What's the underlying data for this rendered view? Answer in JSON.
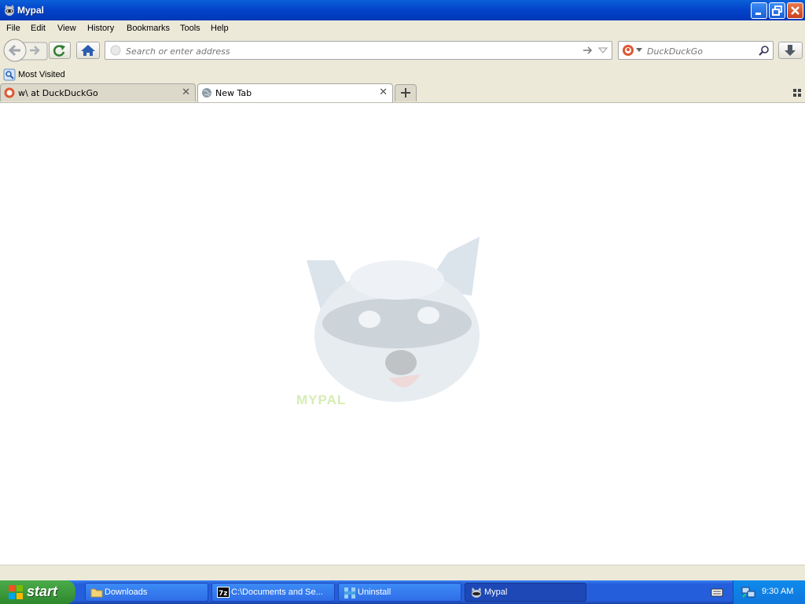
{
  "window": {
    "title": "Mypal"
  },
  "menu": [
    "File",
    "Edit",
    "View",
    "History",
    "Bookmarks",
    "Tools",
    "Help"
  ],
  "nav": {
    "url_placeholder": "Search or enter address",
    "search_placeholder": "DuckDuckGo"
  },
  "bookmarks": {
    "most_visited": "Most Visited"
  },
  "tabs": [
    {
      "label": "w\\ at DuckDuckGo",
      "active": false
    },
    {
      "label": "New Tab",
      "active": true
    }
  ],
  "content": {
    "logo_text": "MYPAL"
  },
  "taskbar": {
    "start": "start",
    "tasks": [
      {
        "label": "Downloads"
      },
      {
        "label": "C:\\Documents and Se..."
      },
      {
        "label": "Uninstall"
      },
      {
        "label": "Mypal"
      }
    ],
    "clock": "9:30 AM"
  },
  "colors": {
    "titlebar": "#0343c9",
    "chrome": "#ece9d8",
    "taskbar": "#245edb",
    "start": "#3c9a3c"
  }
}
